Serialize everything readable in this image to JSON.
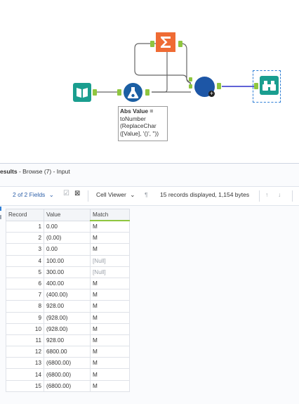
{
  "canvas": {
    "annotation": {
      "title": "Abs Value =",
      "lines": [
        "toNumber",
        "(ReplaceChar",
        "([Value], '()', ''))"
      ]
    },
    "tools": [
      "input-data-tool",
      "formula-tool",
      "summarize-tool",
      "join-tool",
      "browse-tool"
    ]
  },
  "results": {
    "title_prefix": "esults",
    "title_rest": " - Browse (7) - Input",
    "toolbar": {
      "fields": "2 of 2 Fields",
      "viewer": "Cell Viewer",
      "status": "15 records displayed, 1,154 bytes"
    },
    "columns": [
      "Record",
      "Value",
      "Match"
    ],
    "rows": [
      [
        "1",
        "0.00",
        "M"
      ],
      [
        "2",
        "(0.00)",
        "M"
      ],
      [
        "3",
        "0.00",
        "M"
      ],
      [
        "4",
        "100.00",
        "[Null]"
      ],
      [
        "5",
        "300.00",
        "[Null]"
      ],
      [
        "6",
        "400.00",
        "M"
      ],
      [
        "7",
        "(400.00)",
        "M"
      ],
      [
        "8",
        "928.00",
        "M"
      ],
      [
        "9",
        "(928.00)",
        "M"
      ],
      [
        "10",
        "(928.00)",
        "M"
      ],
      [
        "11",
        "928.00",
        "M"
      ],
      [
        "12",
        "6800.00",
        "M"
      ],
      [
        "13",
        "(6800.00)",
        "M"
      ],
      [
        "14",
        "(6800.00)",
        "M"
      ],
      [
        "15",
        "(6800.00)",
        "M"
      ]
    ]
  },
  "colors": {
    "input": "#1a9e8f",
    "formula": "#1b5fa3",
    "summarize": "#ef6b34",
    "join": "#1d56a6",
    "browse": "#1a9e8f",
    "anchor": "#8fc63f",
    "wire_blue": "#2b2fc9"
  }
}
